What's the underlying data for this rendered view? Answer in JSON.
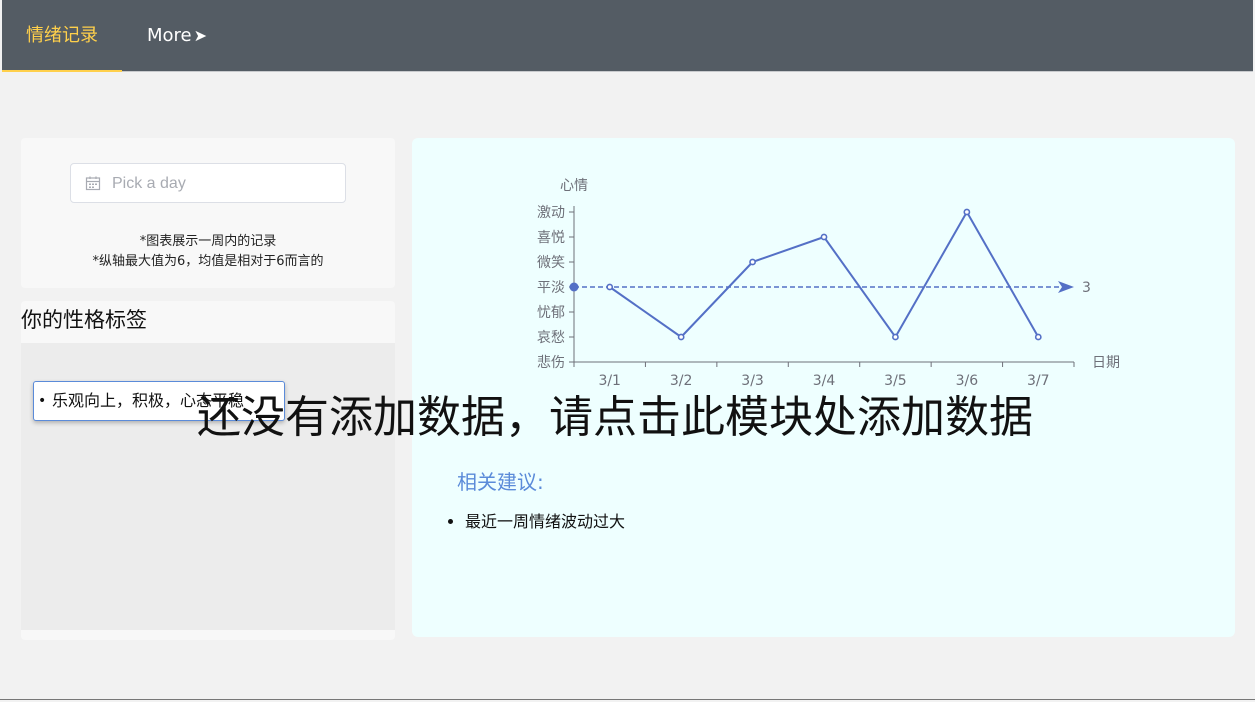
{
  "nav": {
    "active_tab": "情绪记录",
    "more_label": "More",
    "more_arrow": "➤"
  },
  "picker": {
    "placeholder": "Pick a day",
    "icon": "calendar-icon",
    "note1": "*图表展示一周内的记录",
    "note2": "*纵轴最大值为6，均值是相对于6而言的"
  },
  "tags": {
    "title": "你的性格标签",
    "items": [
      "乐观向上，积极，心态平稳"
    ]
  },
  "overlay": {
    "text": "还没有添加数据，请点击此模块处添加数据"
  },
  "advice": {
    "title": "相关建议:",
    "items": [
      "最近一周情绪波动过大"
    ]
  },
  "colors": {
    "nav_bg": "#545c64",
    "active": "#ffd04b",
    "chart_line": "#5470c6",
    "chart_bg": "#eeffff",
    "accent": "#5b8bd9"
  },
  "chart_data": {
    "type": "line",
    "ylabel": "心情",
    "xlabel": "日期",
    "categories": [
      "3/1",
      "3/2",
      "3/3",
      "3/4",
      "3/5",
      "3/6",
      "3/7"
    ],
    "y_categories": [
      "悲伤",
      "哀愁",
      "忧郁",
      "平淡",
      "微笑",
      "喜悦",
      "激动"
    ],
    "values": [
      3,
      1,
      4,
      5,
      1,
      6,
      1
    ],
    "mark_line": {
      "value": 3,
      "label": "3"
    },
    "ylim": [
      0,
      6
    ]
  }
}
